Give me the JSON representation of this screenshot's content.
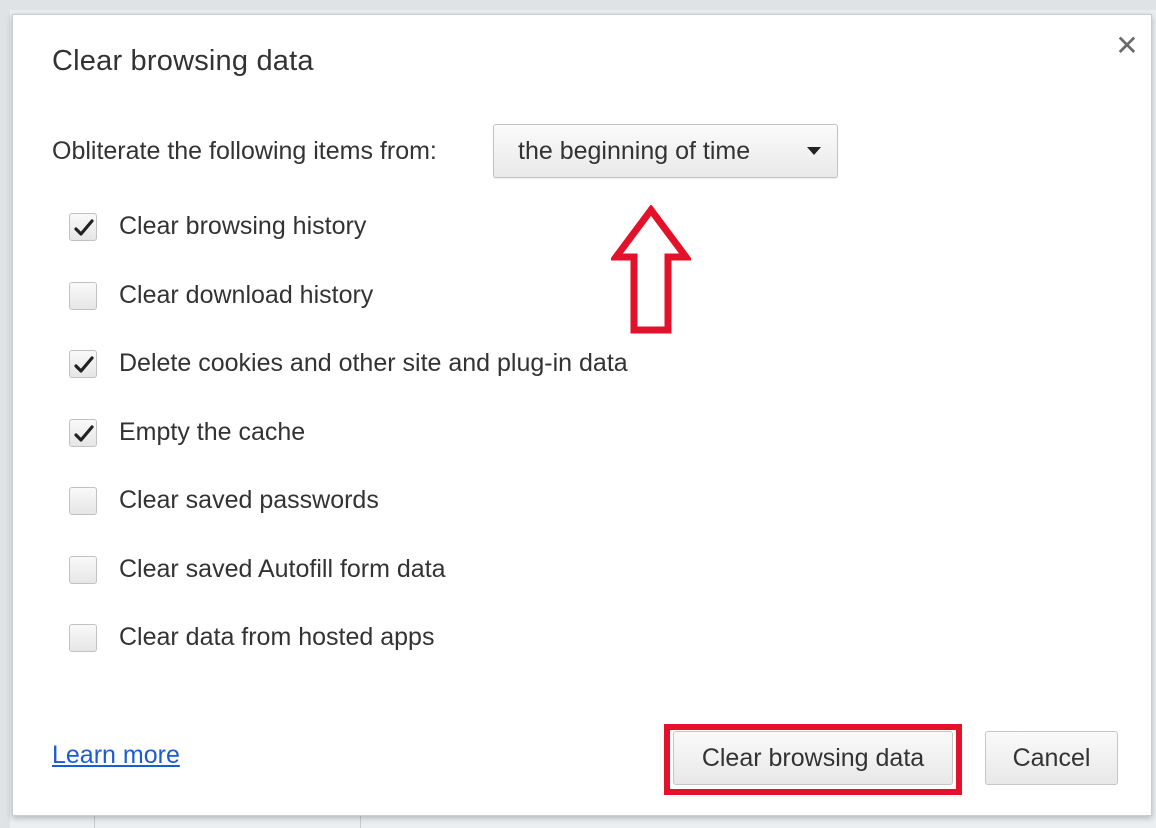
{
  "dialog": {
    "title": "Clear browsing data",
    "close_glyph": "✕",
    "time_range": {
      "label": "Obliterate the following items from:",
      "selected": "the beginning of time"
    },
    "options": [
      {
        "label": "Clear browsing history",
        "checked": true
      },
      {
        "label": "Clear download history",
        "checked": false
      },
      {
        "label": "Delete cookies and other site and plug-in data",
        "checked": true
      },
      {
        "label": "Empty the cache",
        "checked": true
      },
      {
        "label": "Clear saved passwords",
        "checked": false
      },
      {
        "label": "Clear saved Autofill form data",
        "checked": false
      },
      {
        "label": "Clear data from hosted apps",
        "checked": false
      }
    ],
    "learn_more": "Learn more",
    "buttons": {
      "clear": "Clear browsing data",
      "cancel": "Cancel"
    }
  },
  "annotations": {
    "highlight_color": "#e3122a",
    "arrow_icon": "up-arrow-outline-icon"
  }
}
